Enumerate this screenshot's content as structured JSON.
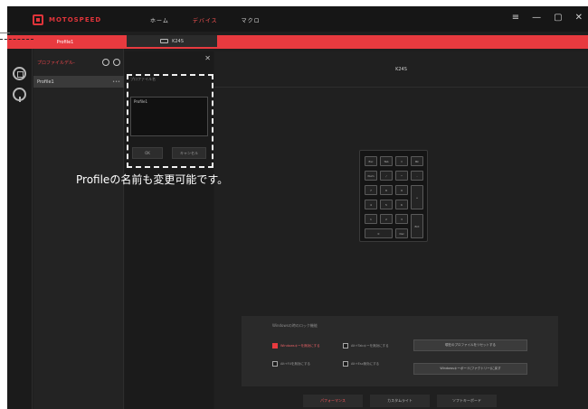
{
  "app": {
    "logo_text": "MOTOSPEED",
    "nav": [
      {
        "label": "ホーム",
        "active": false
      },
      {
        "label": "デバイス",
        "active": true
      },
      {
        "label": "マクロ",
        "active": false
      }
    ],
    "window_controls": {
      "menu": "≡",
      "minimize": "—",
      "maximize": "▢",
      "close": "✕"
    }
  },
  "tabs": {
    "profile_tab": "Profile1",
    "device_tab": "K24S"
  },
  "profile_panel": {
    "title": "プロファイルデル-",
    "items": [
      {
        "name": "Profile1",
        "more": "•••"
      }
    ]
  },
  "dialog": {
    "close": "✕",
    "label": "プロファイル名",
    "input_value": "Profile1",
    "ok": "OK",
    "cancel": "キャンセル"
  },
  "device": {
    "name": "K24S",
    "keys": [
      "Esc",
      "Tab",
      "=",
      "Bk",
      "Num",
      "/",
      "*",
      "-",
      "7",
      "8",
      "9",
      "+",
      "4",
      "5",
      "6",
      "1",
      "2",
      "3",
      "Ent",
      "0",
      "Del"
    ]
  },
  "settings": {
    "title": "Windowsの時のロック機能",
    "checkboxes": [
      {
        "label": "Windowsキーを無効にする",
        "checked": true
      },
      {
        "label": "Alt+Tabキーを無効にする",
        "checked": false
      },
      {
        "label": "Alt+F4を無効にする",
        "checked": false
      },
      {
        "label": "Alt+Esc無効にする",
        "checked": false
      }
    ],
    "buttons": [
      "現在のプロファイルをリセットする",
      "Windowsキーボード(ファクトリー)に戻す"
    ]
  },
  "bottom_tabs": [
    {
      "label": "パフォーマンス",
      "active": true
    },
    {
      "label": "カスタムライト",
      "active": false
    },
    {
      "label": "ソフトキーボード",
      "active": false
    }
  ],
  "annotation": {
    "caption": "Profileの名前も変更可能です。"
  },
  "colors": {
    "accent": "#e83a3f",
    "background": "#1e1e1e",
    "panel": "#232323"
  }
}
